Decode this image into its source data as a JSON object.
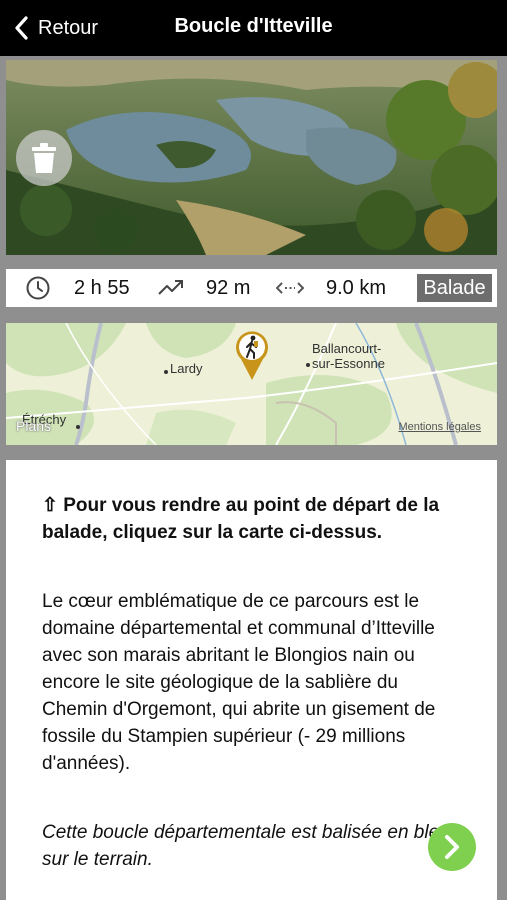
{
  "navbar": {
    "back_label": "Retour",
    "title": "Boucle d'Itteville"
  },
  "stats": {
    "duration": "2 h 55",
    "elevation": "92 m",
    "distance": "9.0 km",
    "badge": "Balade",
    "icons": [
      "clock-icon",
      "trend-up-icon",
      "distance-arrows-icon"
    ]
  },
  "map": {
    "places": [
      "Lardy",
      "Ballancourt-\nsur-Essonne",
      "Étréchy"
    ],
    "provider": "Plans",
    "legal": "Mentions légales",
    "marker_icon": "hiker-icon"
  },
  "content": {
    "intro": "⇧ Pour vous rendre au point de départ de la balade, cliquez sur la carte ci-dessus.",
    "description": "Le cœur emblématique de ce parcours est le domaine départemental et communal d’Itteville avec son marais abritant le Blongios nain ou encore le site géologique de la sablière du Chemin d'Orgemont, qui abrite un gisement de fossile du Stampien supérieur (- 29 millions d'années).",
    "note": "Cette boucle départementale est balisée en bleu sur le terrain."
  },
  "colors": {
    "navbar": "#000000",
    "badge": "#6d6d6d",
    "next_button": "#7ed04e",
    "marker": "#c8951a"
  }
}
